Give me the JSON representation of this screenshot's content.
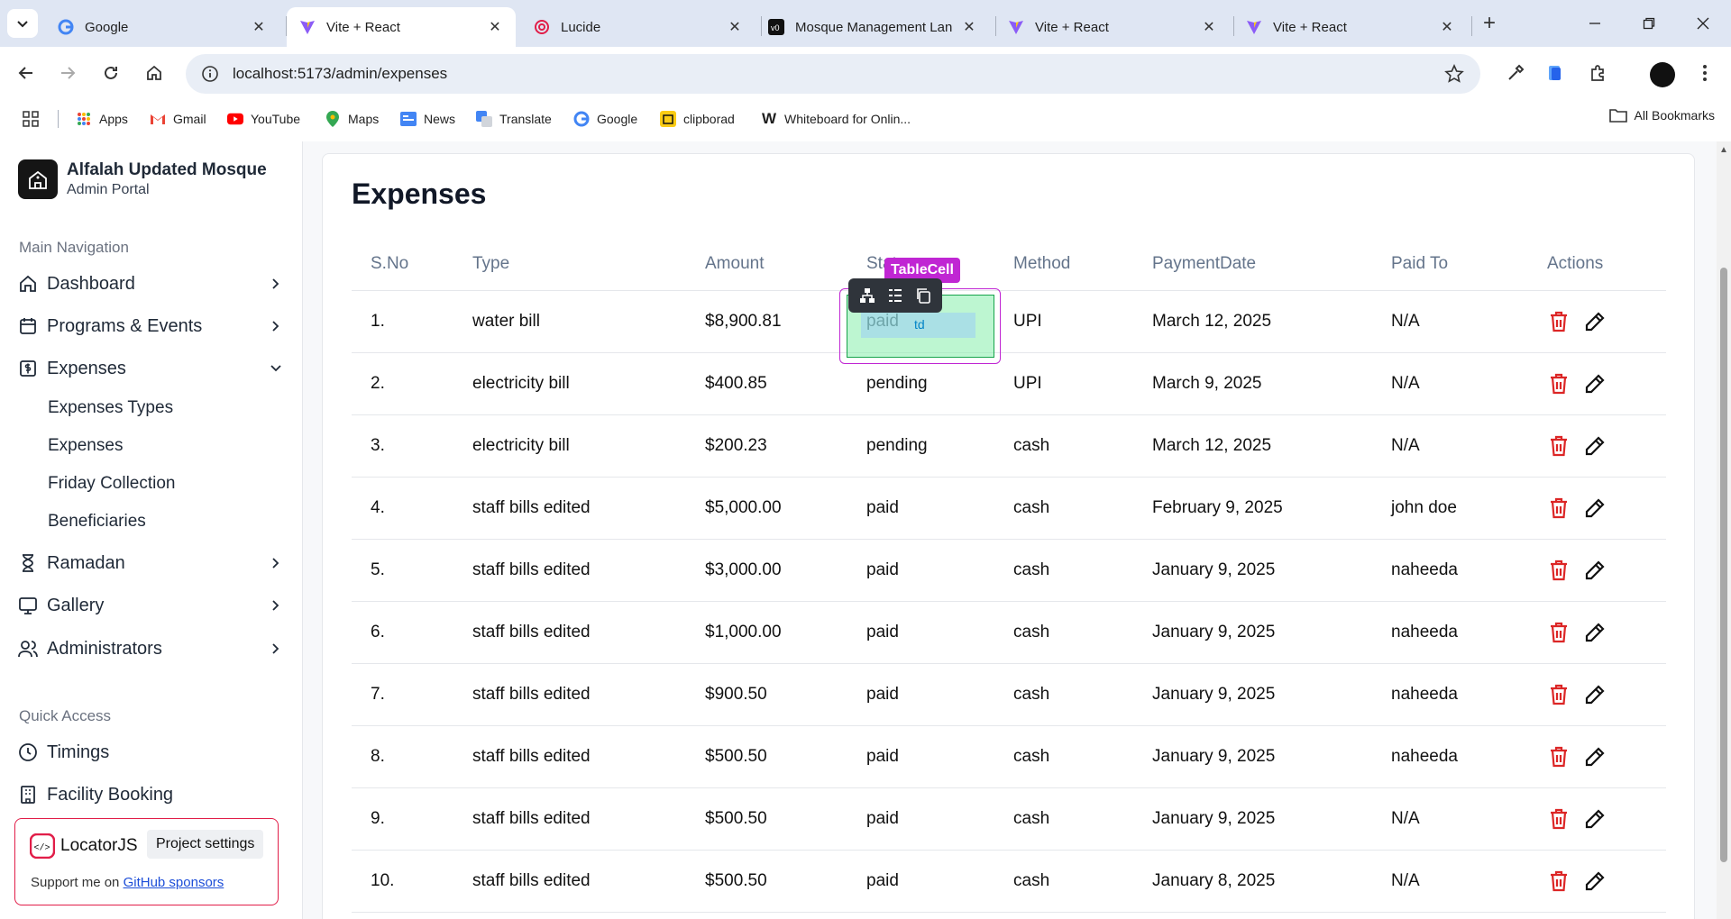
{
  "browser": {
    "tabs": [
      {
        "title": "Google",
        "active": false
      },
      {
        "title": "Vite + React",
        "active": true
      },
      {
        "title": "Lucide",
        "active": false
      },
      {
        "title": "Mosque Management Lan",
        "active": false
      },
      {
        "title": "Vite + React",
        "active": false
      },
      {
        "title": "Vite + React",
        "active": false
      }
    ],
    "url": "localhost:5173/admin/expenses",
    "bookmarks": [
      "Apps",
      "Gmail",
      "YouTube",
      "Maps",
      "News",
      "Translate",
      "Google",
      "clipborad",
      "Whiteboard for Onlin..."
    ],
    "all_bookmarks": "All Bookmarks"
  },
  "sidebar": {
    "brand_title": "Alfalah Updated Mosque",
    "brand_subtitle": "Admin Portal",
    "main_nav_label": "Main Navigation",
    "items": [
      {
        "label": "Dashboard",
        "icon": "home-icon"
      },
      {
        "label": "Programs & Events",
        "icon": "calendar-icon"
      },
      {
        "label": "Expenses",
        "icon": "receipt-icon"
      },
      {
        "label": "Ramadan",
        "icon": "hourglass-icon"
      },
      {
        "label": "Gallery",
        "icon": "monitor-icon"
      },
      {
        "label": "Administrators",
        "icon": "users-icon"
      }
    ],
    "expenses_sub": [
      "Expenses Types",
      "Expenses",
      "Friday Collection",
      "Beneficiaries"
    ],
    "quick_access_label": "Quick Access",
    "quick": [
      {
        "label": "Timings",
        "icon": "clock-icon"
      },
      {
        "label": "Facility Booking",
        "icon": "building-icon"
      }
    ]
  },
  "locatorjs": {
    "name": "LocatorJS",
    "settings": "Project settings",
    "support_prefix": "Support me on ",
    "support_link": "GitHub sponsors",
    "overlay_label": "TableCell",
    "overlay_tag": "td"
  },
  "main": {
    "title": "Expenses",
    "columns": [
      "S.No",
      "Type",
      "Amount",
      "Status",
      "Method",
      "PaymentDate",
      "Paid To",
      "Actions"
    ],
    "rows": [
      [
        "1.",
        "water bill",
        "$8,900.81",
        "paid",
        "UPI",
        "March 12, 2025",
        "N/A"
      ],
      [
        "2.",
        "electricity bill",
        "$400.85",
        "pending",
        "UPI",
        "March 9, 2025",
        "N/A"
      ],
      [
        "3.",
        "electricity bill",
        "$200.23",
        "pending",
        "cash",
        "March 12, 2025",
        "N/A"
      ],
      [
        "4.",
        "staff bills edited",
        "$5,000.00",
        "paid",
        "cash",
        "February 9, 2025",
        "john doe"
      ],
      [
        "5.",
        "staff bills edited",
        "$3,000.00",
        "paid",
        "cash",
        "January 9, 2025",
        "naheeda"
      ],
      [
        "6.",
        "staff bills edited",
        "$1,000.00",
        "paid",
        "cash",
        "January 9, 2025",
        "naheeda"
      ],
      [
        "7.",
        "staff bills edited",
        "$900.50",
        "paid",
        "cash",
        "January 9, 2025",
        "naheeda"
      ],
      [
        "8.",
        "staff bills edited",
        "$500.50",
        "paid",
        "cash",
        "January 9, 2025",
        "naheeda"
      ],
      [
        "9.",
        "staff bills edited",
        "$500.50",
        "paid",
        "cash",
        "January 9, 2025",
        "N/A"
      ],
      [
        "10.",
        "staff bills edited",
        "$500.50",
        "paid",
        "cash",
        "January 8, 2025",
        "N/A"
      ]
    ]
  },
  "colors": {
    "delete": "#dc2626",
    "overlay": "#c026d3",
    "accent": "#111827"
  }
}
